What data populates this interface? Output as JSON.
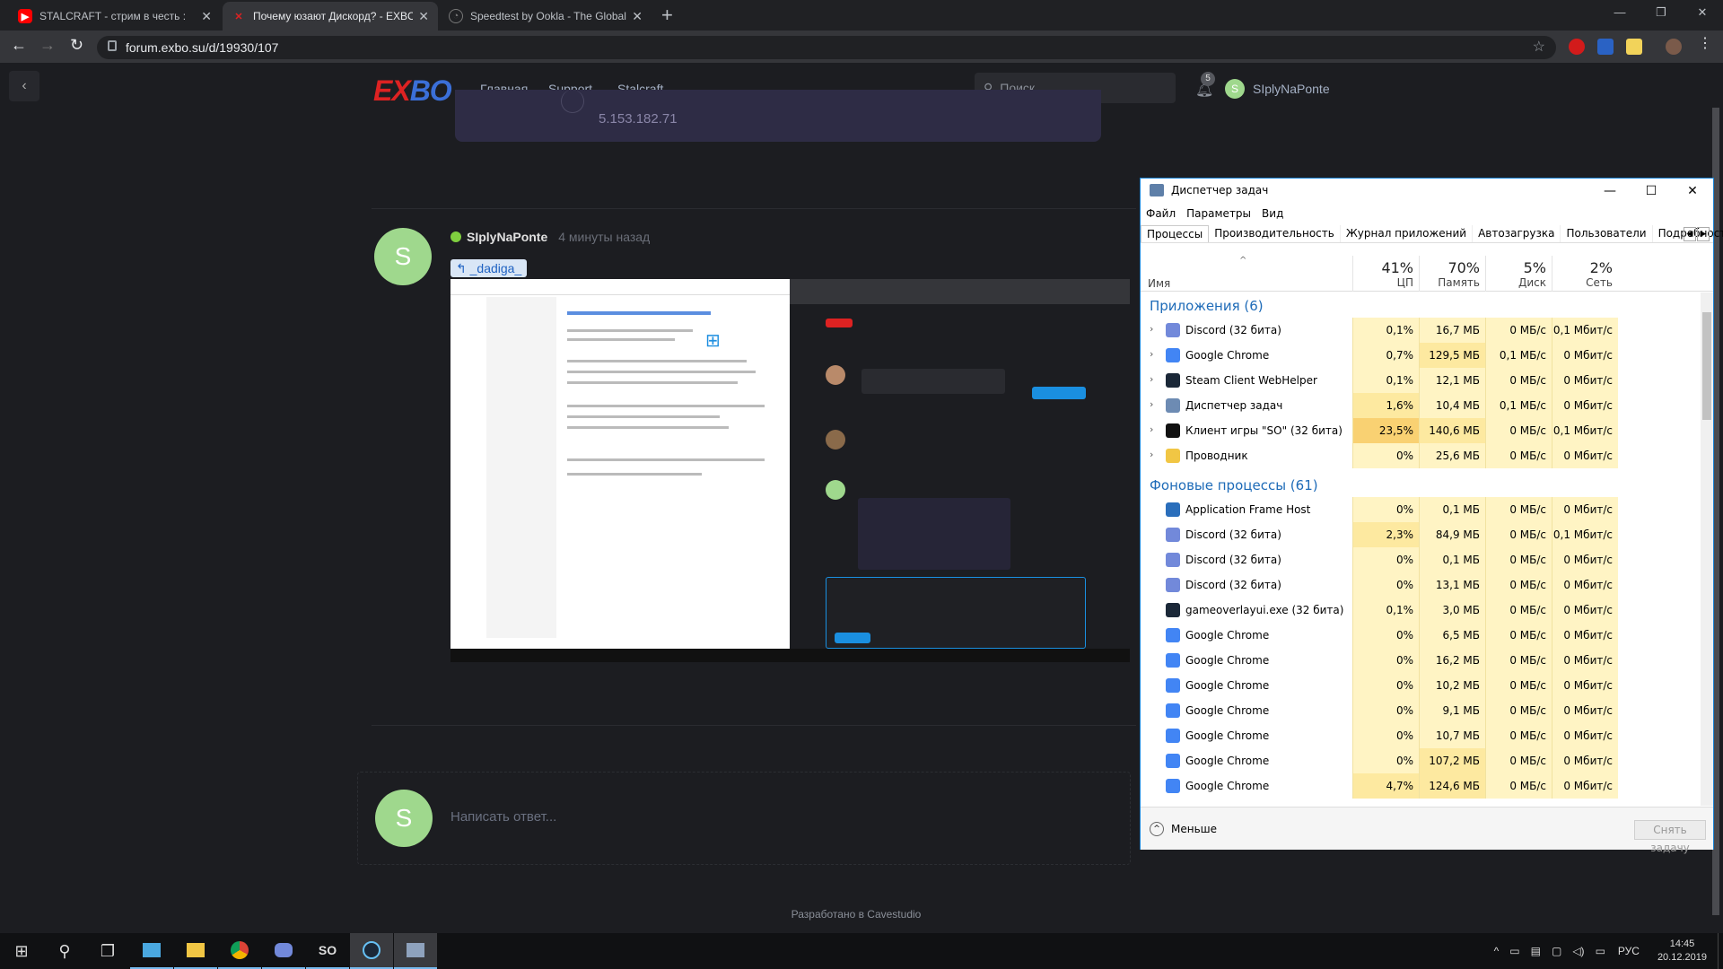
{
  "browser": {
    "tabs": [
      {
        "title": "STALCRAFT - стрим в честь :",
        "favicon": "youtube-icon",
        "color": "#ff0000"
      },
      {
        "title": "Почему юзают Дискорд? - EXBO",
        "favicon": "exbo-icon",
        "color": "#d22222"
      },
      {
        "title": "Speedtest by Ookla - The Global",
        "favicon": "speedtest-icon",
        "color": "#777777"
      }
    ],
    "url": "forum.exbo.su/d/19930/107"
  },
  "site": {
    "nav": {
      "logo_e": "EX",
      "logo_bo": "BO",
      "links": [
        "Главная",
        "Support",
        "Stalcraft"
      ],
      "search_placeholder": "Поиск...",
      "notif_count": "5",
      "user_initial": "S",
      "username": "SIplyNaPonte"
    },
    "ip_text": "5.153.182.71",
    "post": {
      "avatar_initial": "S",
      "username": "SIplyNaPonte",
      "time": "4 минуты назад",
      "mention": "_dadiga_"
    },
    "reply": {
      "avatar_initial": "S",
      "placeholder": "Написать ответ..."
    },
    "footer": "Разработано в Cavestudio"
  },
  "taskmgr": {
    "title": "Диспетчер задач",
    "menu": [
      "Файл",
      "Параметры",
      "Вид"
    ],
    "tabs": [
      "Процессы",
      "Производительность",
      "Журнал приложений",
      "Автозагрузка",
      "Пользователи",
      "Подробности",
      "С"
    ],
    "col_name": "Имя",
    "columns": [
      {
        "pct": "41%",
        "label": "ЦП"
      },
      {
        "pct": "70%",
        "label": "Память"
      },
      {
        "pct": "5%",
        "label": "Диск"
      },
      {
        "pct": "2%",
        "label": "Сеть"
      }
    ],
    "group_apps": "Приложения (6)",
    "apps": [
      {
        "name": "Discord (32 бита)",
        "icon": "discord-icon",
        "cpu": "0,1%",
        "mem": "16,7 МБ",
        "disk": "0 МБ/с",
        "net": "0,1 Мбит/с"
      },
      {
        "name": "Google Chrome",
        "icon": "chrome-icon",
        "cpu": "0,7%",
        "mem": "129,5 МБ",
        "disk": "0,1 МБ/с",
        "net": "0 Мбит/с"
      },
      {
        "name": "Steam Client WebHelper",
        "icon": "steam-icon",
        "cpu": "0,1%",
        "mem": "12,1 МБ",
        "disk": "0 МБ/с",
        "net": "0 Мбит/с"
      },
      {
        "name": "Диспетчер задач",
        "icon": "taskmgr-icon",
        "cpu": "1,6%",
        "mem": "10,4 МБ",
        "disk": "0,1 МБ/с",
        "net": "0 Мбит/с"
      },
      {
        "name": "Клиент игры \"SO\" (32 бита)",
        "icon": "so-game-icon",
        "cpu": "23,5%",
        "mem": "140,6 МБ",
        "disk": "0 МБ/с",
        "net": "0,1 Мбит/с"
      },
      {
        "name": "Проводник",
        "icon": "explorer-icon",
        "cpu": "0%",
        "mem": "25,6 МБ",
        "disk": "0 МБ/с",
        "net": "0 Мбит/с"
      }
    ],
    "group_bg": "Фоновые процессы (61)",
    "bg": [
      {
        "name": "Application Frame Host",
        "icon": "app-frame-icon",
        "cpu": "0%",
        "mem": "0,1 МБ",
        "disk": "0 МБ/с",
        "net": "0 Мбит/с"
      },
      {
        "name": "Discord (32 бита)",
        "icon": "discord-icon",
        "cpu": "2,3%",
        "mem": "84,9 МБ",
        "disk": "0 МБ/с",
        "net": "0,1 Мбит/с"
      },
      {
        "name": "Discord (32 бита)",
        "icon": "discord-icon",
        "cpu": "0%",
        "mem": "0,1 МБ",
        "disk": "0 МБ/с",
        "net": "0 Мбит/с"
      },
      {
        "name": "Discord (32 бита)",
        "icon": "discord-icon",
        "cpu": "0%",
        "mem": "13,1 МБ",
        "disk": "0 МБ/с",
        "net": "0 Мбит/с"
      },
      {
        "name": "gameoverlayui.exe (32 бита)",
        "icon": "steam-icon",
        "cpu": "0,1%",
        "mem": "3,0 МБ",
        "disk": "0 МБ/с",
        "net": "0 Мбит/с"
      },
      {
        "name": "Google Chrome",
        "icon": "chrome-icon",
        "cpu": "0%",
        "mem": "6,5 МБ",
        "disk": "0 МБ/с",
        "net": "0 Мбит/с"
      },
      {
        "name": "Google Chrome",
        "icon": "chrome-icon",
        "cpu": "0%",
        "mem": "16,2 МБ",
        "disk": "0 МБ/с",
        "net": "0 Мбит/с"
      },
      {
        "name": "Google Chrome",
        "icon": "chrome-icon",
        "cpu": "0%",
        "mem": "10,2 МБ",
        "disk": "0 МБ/с",
        "net": "0 Мбит/с"
      },
      {
        "name": "Google Chrome",
        "icon": "chrome-icon",
        "cpu": "0%",
        "mem": "9,1 МБ",
        "disk": "0 МБ/с",
        "net": "0 Мбит/с"
      },
      {
        "name": "Google Chrome",
        "icon": "chrome-icon",
        "cpu": "0%",
        "mem": "10,7 МБ",
        "disk": "0 МБ/с",
        "net": "0 Мбит/с"
      },
      {
        "name": "Google Chrome",
        "icon": "chrome-icon",
        "cpu": "0%",
        "mem": "107,2 МБ",
        "disk": "0 МБ/с",
        "net": "0 Мбит/с"
      },
      {
        "name": "Google Chrome",
        "icon": "chrome-icon",
        "cpu": "4,7%",
        "mem": "124,6 МБ",
        "disk": "0 МБ/с",
        "net": "0 Мбит/с"
      }
    ],
    "less_label": "Меньше",
    "end_task_label": "Снять задачу"
  },
  "taskbar": {
    "lang": "РУС",
    "time": "14:45",
    "date": "20.12.2019"
  }
}
